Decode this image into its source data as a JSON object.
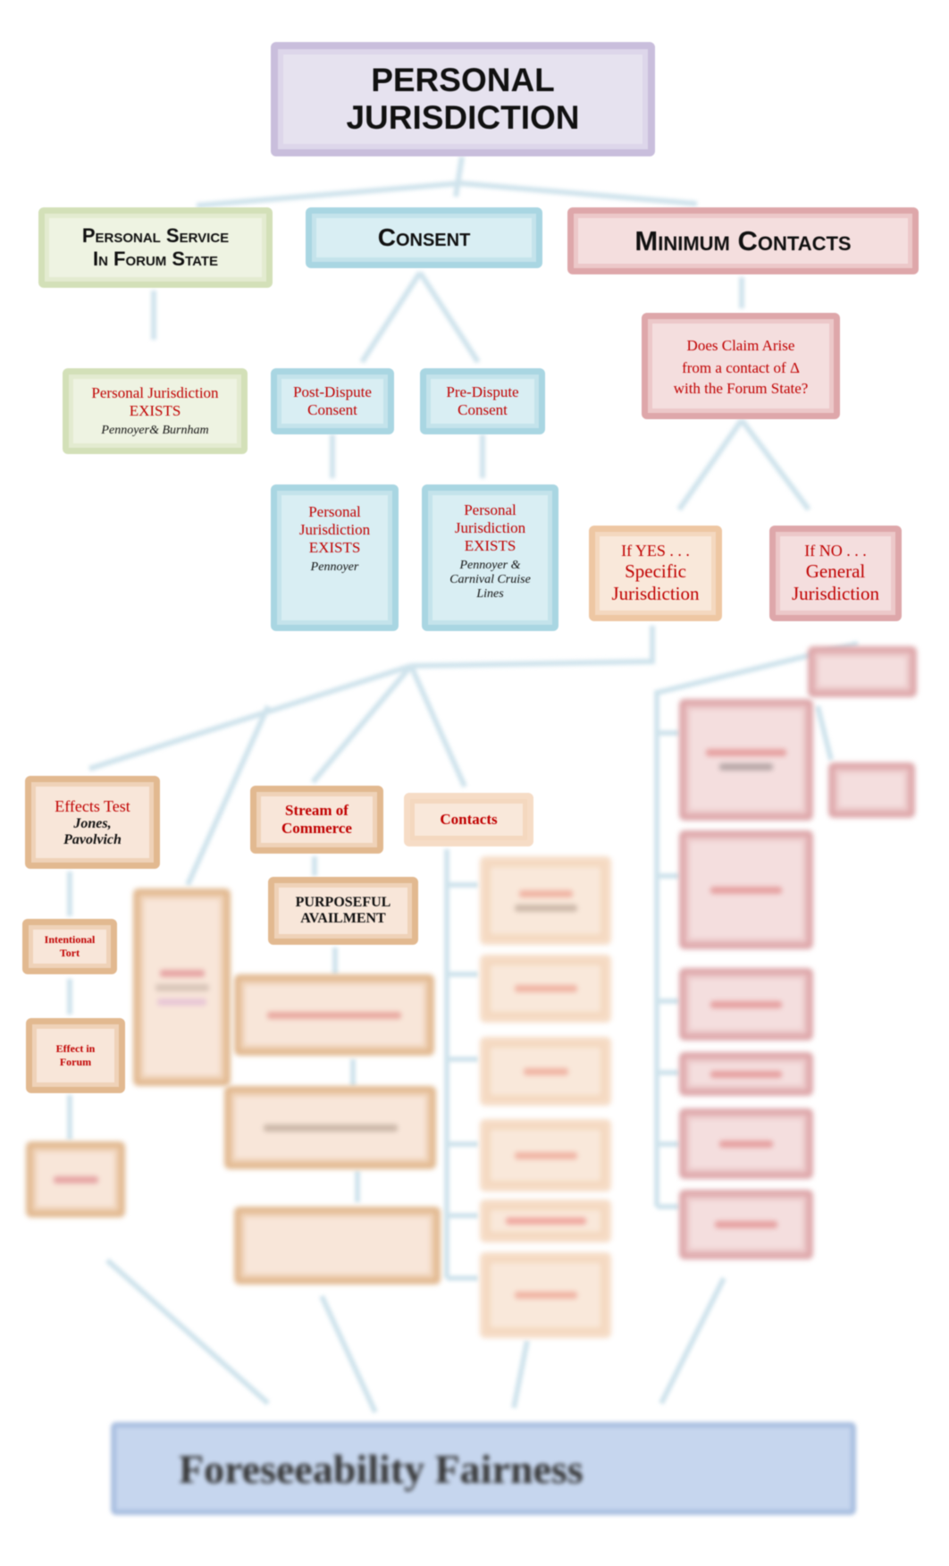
{
  "title": {
    "line1": "PERSONAL",
    "line2": "JURISDICTION"
  },
  "branches": {
    "personal_service": {
      "line1": "Personal Service",
      "line2": "In Forum State"
    },
    "consent": "Consent",
    "minimum_contacts": "Minimum Contacts"
  },
  "personal_service_result": {
    "line1": "Personal Jurisdiction",
    "line2": "EXISTS",
    "cases": "Pennoyer&  Burnham"
  },
  "consent": {
    "post": {
      "line1": "Post-Dispute",
      "line2": "Consent"
    },
    "pre": {
      "line1": "Pre-Dispute",
      "line2": "Consent"
    },
    "post_result": {
      "line1": "Personal",
      "line2": "Jurisdiction",
      "line3": "EXISTS",
      "cases": "Pennoyer"
    },
    "pre_result": {
      "line1": "Personal",
      "line2": "Jurisdiction",
      "line3": "EXISTS",
      "cases1": "Pennoyer &",
      "cases2": "Carnival Cruise",
      "cases3": "Lines"
    }
  },
  "minimum_contacts": {
    "question": {
      "line1": "Does Claim Arise",
      "line2": "from a contact of Δ",
      "line3": "with the Forum State?"
    },
    "yes": {
      "line1": "If YES . . .",
      "line2": "Specific",
      "line3": "Jurisdiction"
    },
    "no": {
      "line1": "If NO . . .",
      "line2": "General",
      "line3": "Jurisdiction"
    }
  },
  "specific": {
    "effects_test": {
      "label": "Effects Test",
      "cases1": "Jones,",
      "cases2": "Pavolvich"
    },
    "intentional_tort": {
      "line1": "Intentional",
      "line2": "Tort"
    },
    "effect_in_forum": {
      "line1": "Effect in",
      "line2": "Forum"
    },
    "stream": {
      "line1": "Stream of",
      "line2": "Commerce"
    },
    "purposeful": {
      "line1": "PURPOSEFUL",
      "line2": "AVAILMENT"
    },
    "contacts": "Contacts"
  },
  "bottom": {
    "label": "Foreseeability Fairness"
  },
  "colors": {
    "purple": "#c9bedc",
    "green": "#d3e0b8",
    "blue": "#a9d6e2",
    "red": "#dea7aa",
    "orange": "#eec7a3",
    "text_red": "#c00000",
    "bottom_blue": "#c6d6ee"
  }
}
